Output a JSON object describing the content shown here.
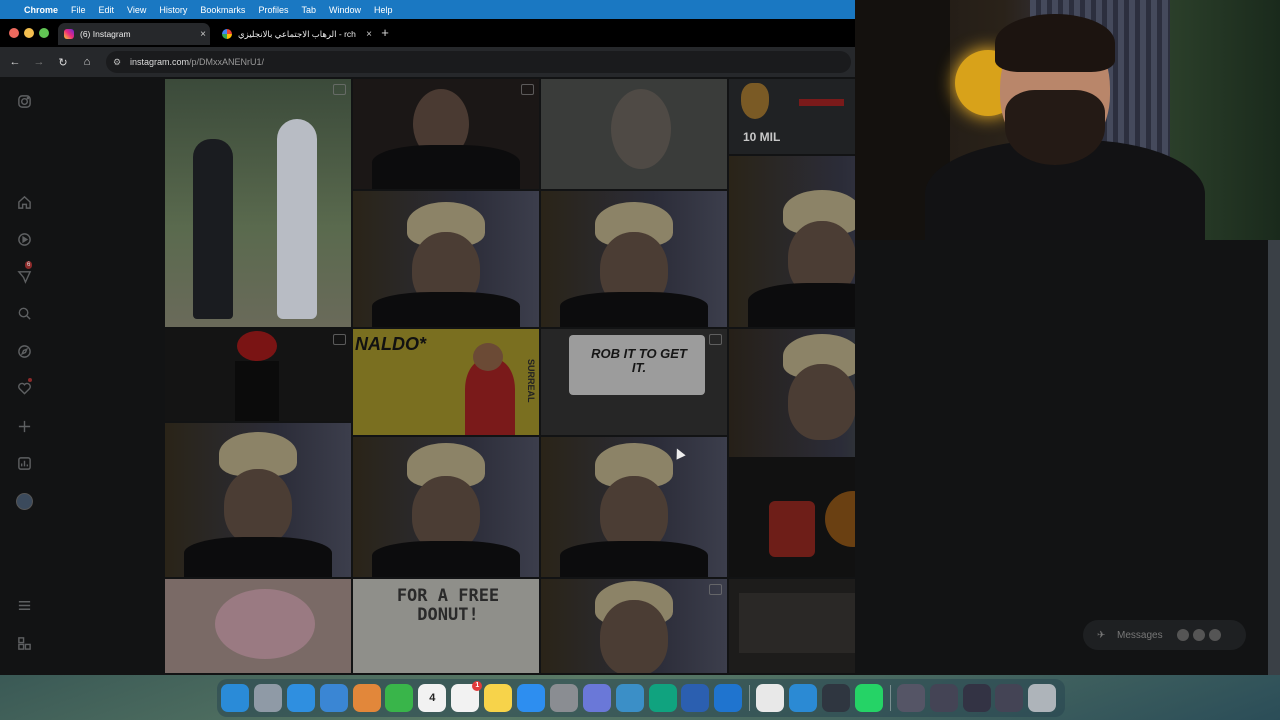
{
  "menubar": {
    "app": "Chrome",
    "items": [
      "File",
      "Edit",
      "View",
      "History",
      "Bookmarks",
      "Profiles",
      "Tab",
      "Window",
      "Help"
    ]
  },
  "tabs": [
    {
      "label": "(6) Instagram",
      "favicon": "instagram-icon",
      "active": true
    },
    {
      "label": "الرهاب الاجتماعي بالانجليزي - rch",
      "favicon": "google-icon",
      "active": false
    }
  ],
  "toolbar": {
    "url_host": "instagram.com",
    "url_path": "/p/DMxxANENrU1/"
  },
  "sidebar": {
    "items": [
      {
        "name": "instagram-logo-icon"
      },
      {
        "name": "home-icon"
      },
      {
        "name": "reels-icon"
      },
      {
        "name": "messages-icon",
        "badge": "6"
      },
      {
        "name": "search-icon"
      },
      {
        "name": "explore-icon"
      },
      {
        "name": "notifications-icon"
      },
      {
        "name": "create-icon"
      },
      {
        "name": "dashboard-icon"
      },
      {
        "name": "profile-avatar"
      },
      {
        "name": "more-icon"
      },
      {
        "name": "also-from-meta-icon"
      }
    ]
  },
  "grid": {
    "overlay_texts": {
      "money": "10 MIL",
      "ronaldo": "NALDO*",
      "rob": "ROB IT TO GET IT.",
      "donut": "FOR A FREE DONUT!",
      "surreal": "SURREAL"
    }
  },
  "messages": {
    "label": "Messages",
    "badge": "6"
  },
  "dock": {
    "items": [
      {
        "name": "finder-icon",
        "color": "#2a8bd8"
      },
      {
        "name": "launchpad-icon",
        "color": "#8f9aa6"
      },
      {
        "name": "safari-icon",
        "color": "#2f8fe0"
      },
      {
        "name": "app-icon-chrome-alt",
        "color": "#3a86d4"
      },
      {
        "name": "photos-icon",
        "color": "#e2873a"
      },
      {
        "name": "facetime-icon",
        "color": "#39b54a"
      },
      {
        "name": "calendar-icon",
        "color": "#f2f2f2",
        "label": "4"
      },
      {
        "name": "reminders-icon",
        "color": "#f2f2f2",
        "badge": "1"
      },
      {
        "name": "notes-icon",
        "color": "#f7d34a"
      },
      {
        "name": "app-store-icon",
        "color": "#2d8ef0"
      },
      {
        "name": "system-settings-icon",
        "color": "#8a8d92"
      },
      {
        "name": "simulator-icon",
        "color": "#6a78d8"
      },
      {
        "name": "vpn-icon",
        "color": "#3b8fc7"
      },
      {
        "name": "chatgpt-icon",
        "color": "#10a37f"
      },
      {
        "name": "word-icon",
        "color": "#2b5fb0"
      },
      {
        "name": "outlook-icon",
        "color": "#1f74cf"
      },
      {
        "name": "chrome-icon",
        "color": "#e8e8e8"
      },
      {
        "name": "updater-icon",
        "color": "#2b8ad4"
      },
      {
        "name": "screen-time-icon",
        "color": "#2f3640"
      },
      {
        "name": "whatsapp-icon",
        "color": "#25d366"
      },
      {
        "name": "recent-window-1",
        "color": "#556"
      },
      {
        "name": "recent-window-2",
        "color": "#445"
      },
      {
        "name": "recent-window-3",
        "color": "#334"
      },
      {
        "name": "recent-window-4",
        "color": "#445"
      },
      {
        "name": "trash-icon",
        "color": "#aeb4ba"
      }
    ]
  }
}
